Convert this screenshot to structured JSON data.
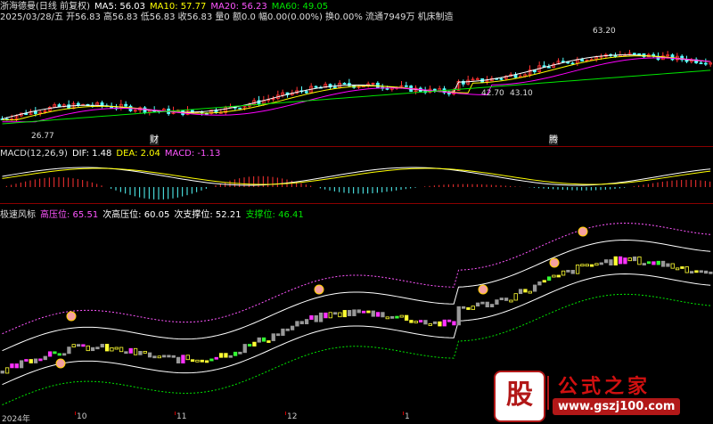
{
  "price_header": {
    "title": "浙海德曼(日线 前复权)",
    "ma5": "MA5: 56.03",
    "ma10": "MA10: 57.77",
    "ma20": "MA20: 56.23",
    "ma60": "MA60: 49.05",
    "info_line": "2025/03/28/五 开56.83 高56.83 低56.83 收56.83 量0 额0.0 幅0.00(0.00%) 换0.00% 流通7949万 机床制造"
  },
  "price_labels": {
    "high_mark": "63.20",
    "low_mark": "26.77",
    "mid_mark": "42.70",
    "mid_mark2": "43.10",
    "event1": "财",
    "event2": "腾"
  },
  "macd_header": {
    "title": "MACD(12,26,9)",
    "dif": "DIF: 1.48",
    "dea": "DEA: 2.04",
    "macd": "MACD: -1.13"
  },
  "indicator_header": {
    "title": "极速风标",
    "high": "高压位: 65.51",
    "second_high": "次高压位: 60.05",
    "second_support": "次支撑位: 52.21",
    "support": "支撑位: 46.41"
  },
  "time_axis": {
    "labels": [
      "2024年",
      "10",
      "11",
      "12",
      "1"
    ]
  },
  "watermark": {
    "logo": "股",
    "brand": "公式之家",
    "url": "www.gszj100.com"
  },
  "colors": {
    "up": "#ff3232",
    "down": "#54ffff",
    "ma5": "#ffffff",
    "ma10": "#ffff00",
    "ma20": "#ff00ff",
    "ma60": "#00e600",
    "separator": "#8a0000"
  },
  "icons": [
    "money-bag-icon",
    "coin-icon"
  ]
}
